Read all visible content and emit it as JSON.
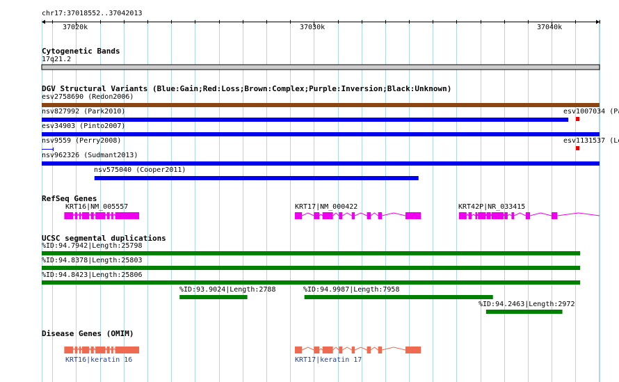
{
  "region": {
    "label": "chr17:37018552..37042013",
    "start": 37018552,
    "end": 37042013,
    "ticks": [
      {
        "pos": 37020000,
        "label": "37020k"
      },
      {
        "pos": 37030000,
        "label": "37030k"
      },
      {
        "pos": 37040000,
        "label": "37040k"
      }
    ]
  },
  "colors": {
    "grid": "#add8e6",
    "band": "#cccccc",
    "brown": "#8b4513",
    "blue": "#0000ee",
    "red": "#ee0000",
    "refseq": "#ee00ee",
    "segdup": "#008000",
    "omim": "#ee6a50",
    "omim_label": "#1f3f94"
  },
  "tracks": {
    "cytoband": {
      "title": "Cytogenetic Bands",
      "band_label": "17q21.2"
    },
    "dgv": {
      "title": "DGV Structural Variants (Blue:Gain;Red:Loss;Brown:Complex;Purple:Inversion;Black:Unknown)",
      "features": [
        {
          "label": "esv2758690 (Redon2006)",
          "start": 37018552,
          "end": 37042013,
          "color": "brown"
        },
        {
          "label": "nsv827992 (Park2010)",
          "start": 37018552,
          "end": 37040700,
          "color": "blue"
        },
        {
          "label": "esv1007034 (Pa",
          "start": 37041020,
          "end": 37041140,
          "color": "red"
        },
        {
          "label": "esv34903 (Pinto2007)",
          "start": 37018552,
          "end": 37042013,
          "color": "blue"
        },
        {
          "label": "nsv9559 (Perry2008)",
          "start": 37018552,
          "end": 37019050,
          "color": "blue"
        },
        {
          "label": "esv1131537 (Le",
          "start": 37041020,
          "end": 37041140,
          "color": "red"
        },
        {
          "label": "nsv962326 (Sudmant2013)",
          "start": 37018552,
          "end": 37042013,
          "color": "blue"
        },
        {
          "label": "nsv575040 (Cooper2011)",
          "start": 37020770,
          "end": 37034400,
          "color": "blue"
        }
      ]
    },
    "refseq": {
      "title": "RefSeq Genes",
      "genes": [
        {
          "label": "KRT16|NM_005557",
          "start": 37019500,
          "end": 37022650,
          "exons": [
            [
              37019500,
              37019870
            ],
            [
              37019950,
              37020050
            ],
            [
              37020130,
              37020200
            ],
            [
              37020250,
              37020550
            ],
            [
              37020620,
              37020740
            ],
            [
              37020810,
              37021230
            ],
            [
              37021290,
              37021410
            ],
            [
              37021480,
              37021560
            ],
            [
              37021640,
              37022650
            ]
          ]
        },
        {
          "label": "KRT17|NM_000422",
          "start": 37029200,
          "end": 37034500,
          "exons": [
            [
              37029200,
              37029500
            ],
            [
              37030000,
              37030230
            ],
            [
              37030360,
              37030800
            ],
            [
              37031050,
              37031200
            ],
            [
              37031590,
              37031720
            ],
            [
              37032230,
              37032390
            ],
            [
              37032700,
              37032860
            ],
            [
              37033850,
              37034500
            ]
          ]
        },
        {
          "label": "KRT42P|NR_033415",
          "start": 37036100,
          "end": 37042013,
          "exons": [
            [
              37036100,
              37036420
            ],
            [
              37036500,
              37036640
            ],
            [
              37036790,
              37036870
            ],
            [
              37036900,
              37037230
            ],
            [
              37037260,
              37037440
            ],
            [
              37037470,
              37037980
            ],
            [
              37038010,
              37038150
            ],
            [
              37038310,
              37038420
            ],
            [
              37038910,
              37039090
            ],
            [
              37039990,
              37040240
            ]
          ]
        }
      ]
    },
    "segdup": {
      "title": "UCSC segmental duplications",
      "features": [
        {
          "label": "%ID:94.7942|Length:25798",
          "start": 37018552,
          "end": 37041200
        },
        {
          "label": "%ID:94.8378|Length:25803",
          "start": 37018552,
          "end": 37041200
        },
        {
          "label": "%ID:94.8423|Length:25806",
          "start": 37018552,
          "end": 37041200
        },
        {
          "label": "%ID:93.9024|Length:2788",
          "start": 37024350,
          "end": 37027200
        },
        {
          "label": "%ID:94.9987|Length:7958",
          "start": 37029600,
          "end": 37037530
        },
        {
          "label": "%ID:94.2463|Length:2972",
          "start": 37037240,
          "end": 37040450
        }
      ]
    },
    "omim": {
      "title": "Disease Genes (OMIM)",
      "genes": [
        {
          "label": "KRT16|keratin 16",
          "start": 37019500,
          "end": 37022650,
          "exons": [
            [
              37019500,
              37019870
            ],
            [
              37019950,
              37020050
            ],
            [
              37020130,
              37020200
            ],
            [
              37020250,
              37020550
            ],
            [
              37020620,
              37020740
            ],
            [
              37020810,
              37021230
            ],
            [
              37021290,
              37021410
            ],
            [
              37021480,
              37021560
            ],
            [
              37021640,
              37022650
            ]
          ]
        },
        {
          "label": "KRT17|keratin 17",
          "start": 37029200,
          "end": 37034500,
          "exons": [
            [
              37029200,
              37029500
            ],
            [
              37030000,
              37030230
            ],
            [
              37030360,
              37030800
            ],
            [
              37031050,
              37031200
            ],
            [
              37031590,
              37031720
            ],
            [
              37032230,
              37032390
            ],
            [
              37032700,
              37032860
            ],
            [
              37033850,
              37034500
            ]
          ]
        }
      ]
    }
  }
}
